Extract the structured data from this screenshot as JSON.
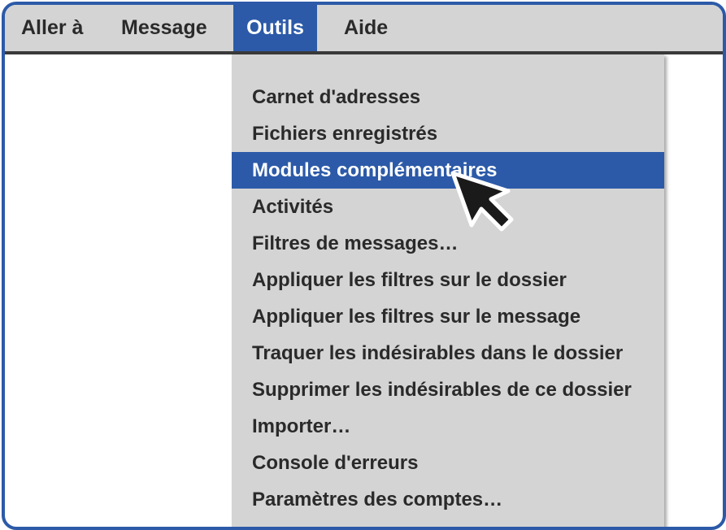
{
  "menubar": {
    "items": [
      {
        "label": "Aller à"
      },
      {
        "label": "Message"
      },
      {
        "label": "Outils"
      },
      {
        "label": "Aide"
      }
    ],
    "active_index": 2
  },
  "dropdown": {
    "items": [
      {
        "label": "Carnet d'adresses"
      },
      {
        "label": "Fichiers enregistrés"
      },
      {
        "label": "Modules complémentaires"
      },
      {
        "label": "Activités"
      },
      {
        "label": "Filtres de messages…"
      },
      {
        "label": "Appliquer les filtres sur le dossier"
      },
      {
        "label": "Appliquer les filtres sur le message"
      },
      {
        "label": "Traquer les indésirables dans le dossier"
      },
      {
        "label": "Supprimer les indésirables de ce dossier"
      },
      {
        "label": "Importer…"
      },
      {
        "label": "Console d'erreurs"
      },
      {
        "label": "Paramètres des comptes…"
      }
    ],
    "highlighted_index": 2
  },
  "colors": {
    "accent": "#2c5aa8",
    "menu_background": "#d4d4d4",
    "text": "#2a2a2a"
  },
  "icons": {
    "cursor": "mouse-pointer-icon"
  }
}
